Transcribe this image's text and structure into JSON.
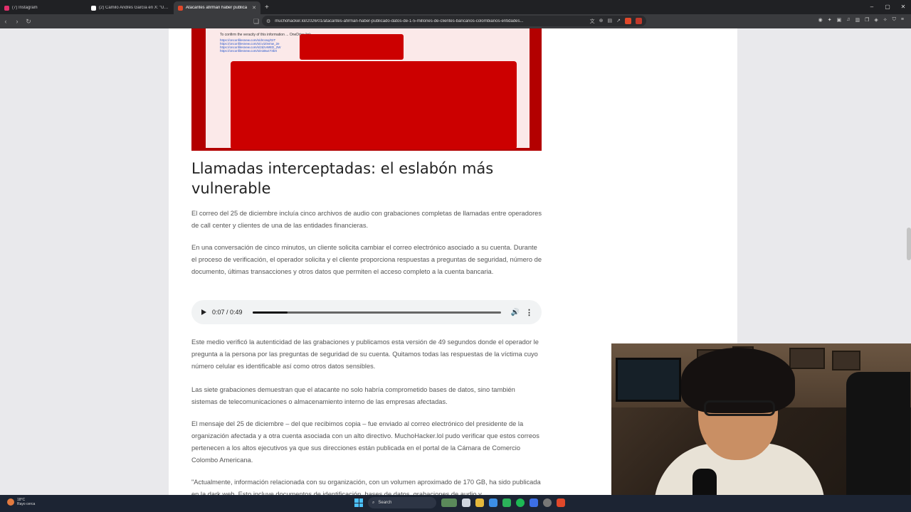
{
  "browser": {
    "tabs": [
      {
        "title": "(7) Instagram",
        "favicon_color": "#e1306c",
        "active": false
      },
      {
        "title": "(2) Camilo Andrés García en X: \"Un g",
        "favicon_color": "#ffffff",
        "active": false
      },
      {
        "title": "Atacantes afirman haber publica",
        "favicon_color": "#e0482a",
        "active": true
      }
    ],
    "new_tab": "+",
    "url": "muchohacker.lol/2026/01/atacantes-afirman-haber-publicado-datos-de-1-5-millones-de-clientes-bancarios-colombianos-entidades...",
    "window_controls": [
      "–",
      "▢",
      "✕"
    ]
  },
  "article": {
    "hero_image": {
      "text_line": "To confirm the veracity of this information ... OneDrive link.",
      "links": [
        "https://onconfilesnew.com/s/drcssq/GIT",
        "https://onconfilesnew.com/s/cv1i0vmw_2e",
        "https://onconfilesnew.com/s/2dzvWED_2W",
        "https://onconfilesnew.com/s/e1Bwz73bX"
      ],
      "redaction_color": "#cc0000"
    },
    "heading": "Llamadas interceptadas: el eslabón más vulnerable",
    "paragraphs_top": [
      "El correo del 25 de diciembre incluía cinco archivos de audio con grabaciones completas de llamadas entre operadores de call center y clientes de una de las entidades financieras.",
      "En una conversación de cinco minutos, un cliente solicita cambiar el correo electrónico asociado a su cuenta. Durante el proceso de verificación, el operador solicita y el cliente proporciona respuestas a preguntas de seguridad, número de documento, últimas transacciones y otros datos que permiten el acceso completo a la cuenta bancaria."
    ],
    "audio": {
      "time": "0:07 / 0:49",
      "progress": 0.143
    },
    "paragraphs_bottom": [
      "Este medio verificó la autenticidad de las grabaciones y publicamos esta versión de 49 segundos donde el operador le pregunta a la persona por las preguntas de seguridad de su cuenta.  Quitamos todas las respuestas de la víctima cuyo número celular es identificable así como otros datos sensibles.",
      "Las siete grabaciones demuestran que el atacante no solo habría comprometido bases de datos, sino también sistemas de telecomunicaciones o almacenamiento interno de las empresas afectadas.",
      "El mensaje del 25 de diciembre – del que recibimos copia – fue enviado al correo electrónico del presidente de la organización afectada y a otra cuenta asociada con un alto directivo. MuchoHacker.lol pudo verificar que estos correos pertenecen a los altos ejecutivos ya que sus direcciones están publicada en el portal de la Cámara de Comercio Colombo Americana.",
      "\"Actualmente, información relacionada con su organización, con un volumen aproximado de 170 GB, ha sido publicada en la dark web. Esto incluye documentos de identificación, bases de datos, grabaciones de audio y"
    ]
  },
  "taskbar": {
    "weather_temp": "18°C",
    "weather_desc": "Rayo cerca",
    "search_label": "Search",
    "app_colors": [
      "#e6b93c",
      "#3c8fe6",
      "#2bb35a",
      "#1db954",
      "#3c6fe6",
      "#777777",
      "#e0482a"
    ]
  }
}
